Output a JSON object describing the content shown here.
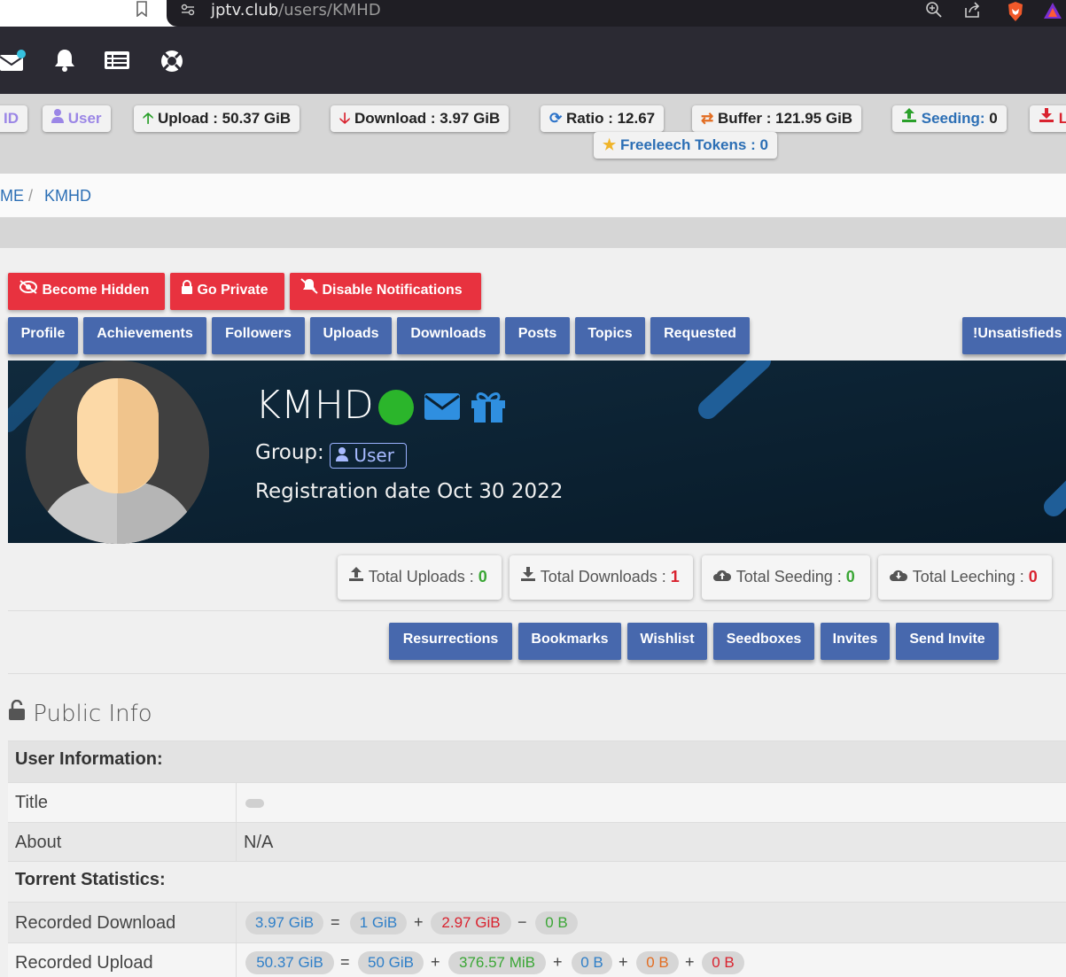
{
  "browser": {
    "url_host": "jptv.club",
    "url_path": "/users/KMHD"
  },
  "ratio_bar": {
    "id_fragment": "ID",
    "group": "User",
    "upload": "Upload : 50.37 GiB",
    "download": "Download : 3.97 GiB",
    "ratio": "Ratio : 12.67",
    "buffer": "Buffer : 121.95 GiB",
    "seeding_label": "Seeding:",
    "seeding_value": "0",
    "leeching_fragment": "L",
    "freeleech": "Freeleech Tokens : 0"
  },
  "breadcrumb": {
    "home": "ME",
    "separator": "/",
    "current": "KMHD"
  },
  "actions": {
    "become_hidden": "Become Hidden",
    "go_private": "Go Private",
    "disable_notifications": "Disable Notifications"
  },
  "tabs": [
    "Profile",
    "Achievements",
    "Followers",
    "Uploads",
    "Downloads",
    "Posts",
    "Topics",
    "Requested"
  ],
  "unsatisfieds": "Unsatisfieds",
  "profile": {
    "username": "KMHD",
    "group_label": "Group:",
    "group": "User",
    "registration": "Registration date Oct 30 2022"
  },
  "totals": [
    {
      "label": "Total Uploads :",
      "value": "0"
    },
    {
      "label": "Total Downloads :",
      "value": "1"
    },
    {
      "label": "Total Seeding :",
      "value": "0"
    },
    {
      "label": "Total Leeching :",
      "value": "0"
    }
  ],
  "secondary_buttons": [
    "Resurrections",
    "Bookmarks",
    "Wishlist",
    "Seedboxes",
    "Invites",
    "Send Invite"
  ],
  "public_info": {
    "heading": "Public Info",
    "user_information": "User Information:",
    "title_label": "Title",
    "about_label": "About",
    "about_value": "N/A",
    "torrent_statistics": "Torrent Statistics:",
    "recorded_download": {
      "label": "Recorded Download",
      "values": [
        "3.97 GiB",
        "1 GiB",
        "2.97 GiB",
        "0 B"
      ],
      "ops": [
        "=",
        "+",
        "−"
      ]
    },
    "recorded_upload": {
      "label": "Recorded Upload",
      "values": [
        "50.37 GiB",
        "50 GiB",
        "376.57 MiB",
        "0 B",
        "0 B",
        "0 B"
      ],
      "ops": [
        "=",
        "+",
        "+",
        "+",
        "+"
      ]
    }
  },
  "colors": {
    "red_button": "#e8323f",
    "blue_button": "#4768ad",
    "banner": "#0c2233",
    "link": "#2c6fb5",
    "green": "#3aa635",
    "danger": "#d9232f"
  }
}
